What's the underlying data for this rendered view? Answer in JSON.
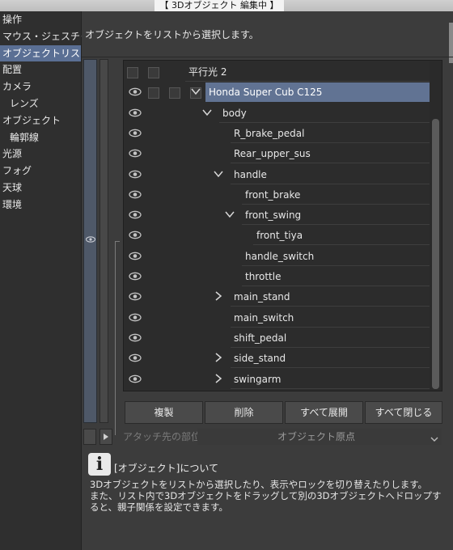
{
  "window": {
    "title": "【 3Dオブジェクト 編集中 】"
  },
  "sidebar": {
    "items": [
      {
        "label": "操作"
      },
      {
        "label": "マウス・ジェスチャー"
      },
      {
        "label": "オブジェクトリスト",
        "active": true
      },
      {
        "label": "配置"
      },
      {
        "label": "カメラ"
      },
      {
        "label": "レンズ",
        "sub": true
      },
      {
        "label": "オブジェクト"
      },
      {
        "label": "輪郭線",
        "sub": true
      },
      {
        "label": "光源"
      },
      {
        "label": "フォグ"
      },
      {
        "label": "天球"
      },
      {
        "label": "環境"
      }
    ]
  },
  "panel": {
    "hint": "オブジェクトをリストから選択します。"
  },
  "tree": {
    "rows": [
      {
        "name": "平行光 2",
        "eye": false,
        "checks": 2,
        "chevron": "",
        "level": 0
      },
      {
        "name": "Honda Super Cub C125",
        "eye": true,
        "checks": 3,
        "chevron": "down",
        "level": 0,
        "selected": true
      },
      {
        "name": "body",
        "eye": true,
        "chevron": "down",
        "level": 1
      },
      {
        "name": "R_brake_pedal",
        "eye": true,
        "chevron": "",
        "level": 2
      },
      {
        "name": "Rear_upper_sus",
        "eye": true,
        "chevron": "",
        "level": 2
      },
      {
        "name": "handle",
        "eye": true,
        "chevron": "down",
        "level": 2
      },
      {
        "name": "front_brake",
        "eye": true,
        "chevron": "",
        "level": 3
      },
      {
        "name": "front_swing",
        "eye": true,
        "chevron": "down",
        "level": 3
      },
      {
        "name": "front_tiya",
        "eye": true,
        "chevron": "",
        "level": 4
      },
      {
        "name": "handle_switch",
        "eye": true,
        "chevron": "",
        "level": 3
      },
      {
        "name": "throttle",
        "eye": true,
        "chevron": "",
        "level": 3
      },
      {
        "name": "main_stand",
        "eye": true,
        "chevron": "right",
        "level": 2
      },
      {
        "name": "main_switch",
        "eye": true,
        "chevron": "",
        "level": 2
      },
      {
        "name": "shift_pedal",
        "eye": true,
        "chevron": "",
        "level": 2
      },
      {
        "name": "side_stand",
        "eye": true,
        "chevron": "right",
        "level": 2
      },
      {
        "name": "swingarm",
        "eye": true,
        "chevron": "right",
        "level": 2
      }
    ]
  },
  "buttons": {
    "duplicate": "複製",
    "delete": "削除",
    "expand_all": "すべて展開",
    "collapse_all": "すべて閉じる"
  },
  "attach": {
    "label": "アタッチ先の部位"
  },
  "origin": {
    "label": "オブジェクト原点"
  },
  "info": {
    "title": "[オブジェクト]について",
    "line1": "3Dオブジェクトをリストから選択したり、表示やロックを切り替えたりします。",
    "line2": "また、リスト内で3Dオブジェクトをドラッグして別の3Dオブジェクトへドロップすると、親子関係を設定できます。"
  }
}
